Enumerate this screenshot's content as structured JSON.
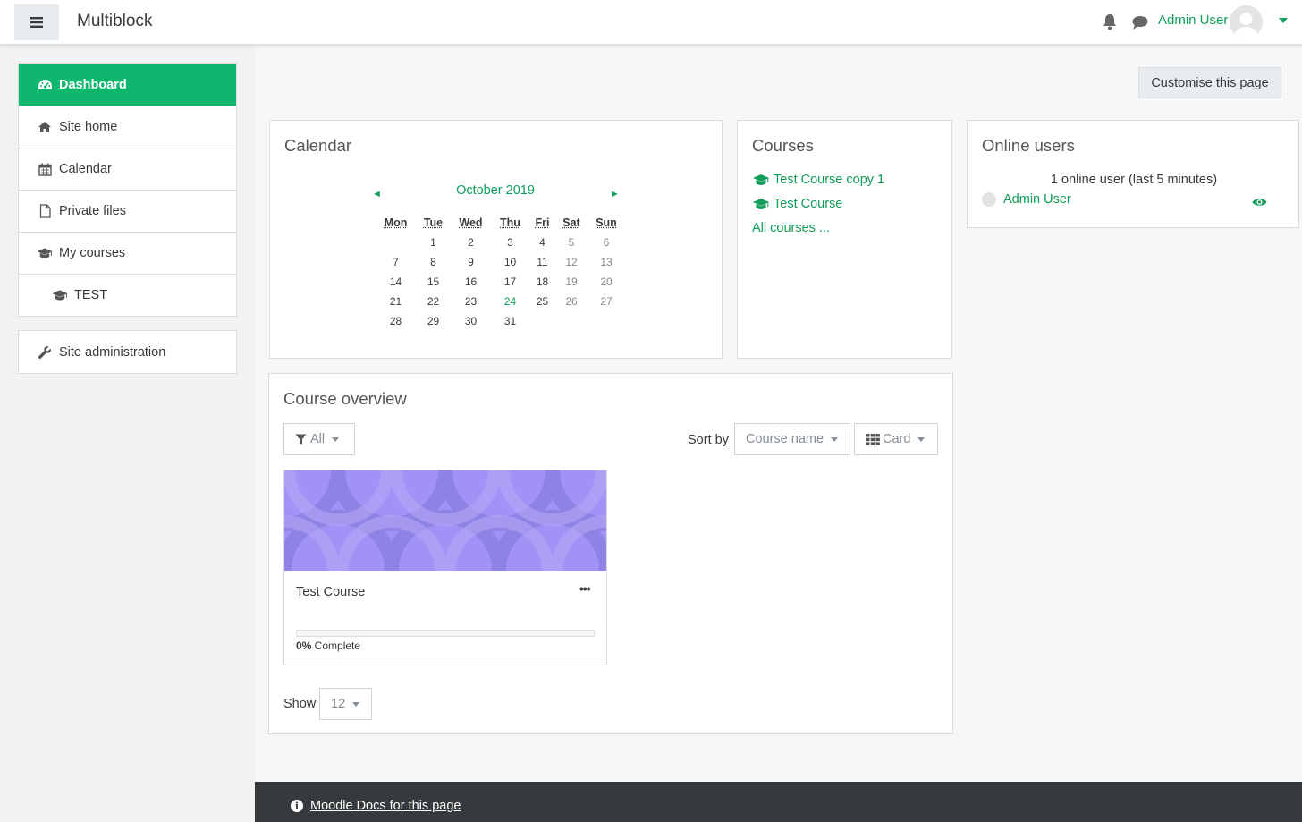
{
  "header": {
    "site_name": "Multiblock",
    "user_name": "Admin User"
  },
  "drawer": {
    "items": [
      {
        "label": "Dashboard",
        "icon": "dashboard-icon",
        "active": true
      },
      {
        "label": "Site home",
        "icon": "home-icon"
      },
      {
        "label": "Calendar",
        "icon": "calendar-icon"
      },
      {
        "label": "Private files",
        "icon": "file-icon"
      },
      {
        "label": "My courses",
        "icon": "graduation-cap-icon"
      },
      {
        "label": "TEST",
        "icon": "graduation-cap-icon"
      }
    ],
    "admin": {
      "label": "Site administration",
      "icon": "wrench-icon"
    }
  },
  "main": {
    "customise_label": "Customise this page"
  },
  "calendar": {
    "title": "Calendar",
    "month": "October 2019",
    "prev": "◄",
    "next": "►",
    "days": [
      "Mon",
      "Tue",
      "Wed",
      "Thu",
      "Fri",
      "Sat",
      "Sun"
    ],
    "weeks": [
      [
        "",
        "1",
        "2",
        "3",
        "4",
        "5",
        "6"
      ],
      [
        "7",
        "8",
        "9",
        "10",
        "11",
        "12",
        "13"
      ],
      [
        "14",
        "15",
        "16",
        "17",
        "18",
        "19",
        "20"
      ],
      [
        "21",
        "22",
        "23",
        "24",
        "25",
        "26",
        "27"
      ],
      [
        "28",
        "29",
        "30",
        "31",
        "",
        "",
        ""
      ]
    ],
    "today": "24"
  },
  "courses_block": {
    "title": "Courses",
    "items": [
      "Test Course copy 1",
      "Test Course"
    ],
    "all_courses": "All courses ..."
  },
  "online_users": {
    "title": "Online users",
    "summary": "1 online user (last 5 minutes)",
    "user": "Admin User"
  },
  "course_overview": {
    "title": "Course overview",
    "filter": "All",
    "sort_label": "Sort by",
    "sort_value": "Course name",
    "view_value": "Card",
    "card": {
      "title": "Test Course",
      "menu": "•••",
      "progress_percent": "0%",
      "progress_suffix": " Complete"
    },
    "show_label": "Show",
    "show_value": "12"
  },
  "footer": {
    "docs_link": "Moodle Docs for this page"
  },
  "colors": {
    "accent": "#0fb66e",
    "link": "#0f9d58",
    "footer": "#373a3c",
    "card_image": "#a193f5"
  }
}
